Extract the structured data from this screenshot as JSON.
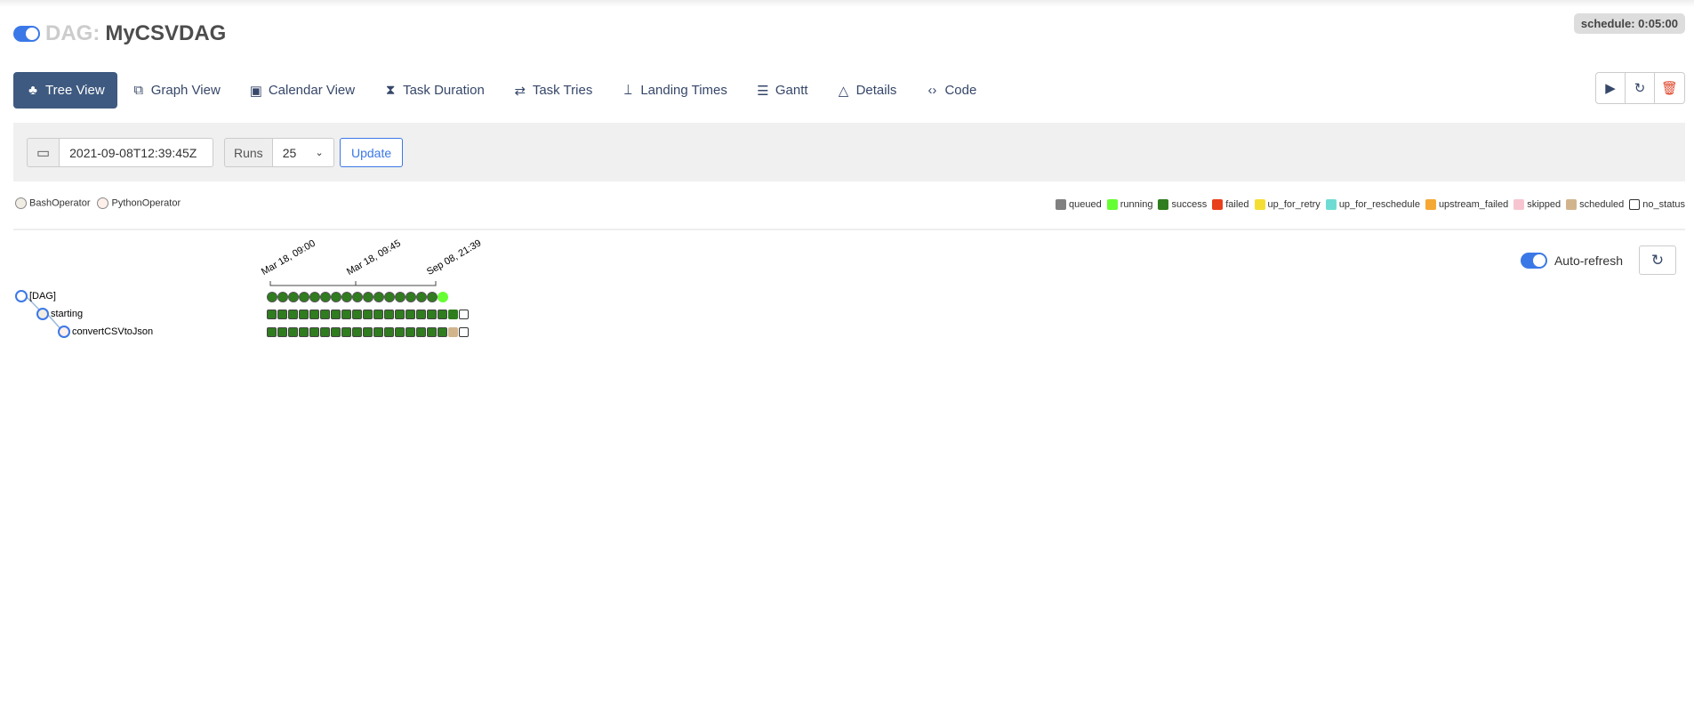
{
  "header": {
    "title_prefix": "DAG:",
    "dag_name": "MyCSVDAG",
    "schedule": "schedule: 0:05:00",
    "paused_toggle_on": true
  },
  "nav": [
    {
      "label": "Tree View",
      "icon": "tree-icon",
      "glyph": "♣",
      "active": true
    },
    {
      "label": "Graph View",
      "icon": "graph-icon",
      "glyph": "⧉"
    },
    {
      "label": "Calendar View",
      "icon": "calendar-icon",
      "glyph": "▣"
    },
    {
      "label": "Task Duration",
      "icon": "hourglass-icon",
      "glyph": "⧗"
    },
    {
      "label": "Task Tries",
      "icon": "repeat-icon",
      "glyph": "⇄"
    },
    {
      "label": "Landing Times",
      "icon": "plane-landing-icon",
      "glyph": "⟘"
    },
    {
      "label": "Gantt",
      "icon": "gantt-icon",
      "glyph": "☰"
    },
    {
      "label": "Details",
      "icon": "warning-triangle-icon",
      "glyph": "△"
    },
    {
      "label": "Code",
      "icon": "code-icon",
      "glyph": "‹›"
    }
  ],
  "actions": {
    "trigger": "▶",
    "refresh": "↻",
    "delete": "🗑"
  },
  "filter": {
    "base_date": "2021-09-08T12:39:45Z",
    "runs_label": "Runs",
    "runs_value": "25",
    "update_label": "Update"
  },
  "operators": [
    {
      "label": "BashOperator",
      "color": "#f0ede4"
    },
    {
      "label": "PythonOperator",
      "color": "#ffefeb"
    }
  ],
  "legend": [
    {
      "label": "queued",
      "color": "#808080"
    },
    {
      "label": "running",
      "color": "#66ff33"
    },
    {
      "label": "success",
      "color": "#2f7d1e"
    },
    {
      "label": "failed",
      "color": "#e8401c"
    },
    {
      "label": "up_for_retry",
      "color": "#f5de34"
    },
    {
      "label": "up_for_reschedule",
      "color": "#6fdcd3"
    },
    {
      "label": "upstream_failed",
      "color": "#f5a833"
    },
    {
      "label": "skipped",
      "color": "#f7c5cf"
    },
    {
      "label": "scheduled",
      "color": "#d2b48c"
    },
    {
      "label": "no_status",
      "color": "#ffffff"
    }
  ],
  "auto_refresh": {
    "label": "Auto-refresh",
    "on": true
  },
  "tree": {
    "ticks": [
      "Mar 18, 09:00",
      "Mar 18, 09:45",
      "Sep 08, 21:39"
    ],
    "tasks": [
      {
        "label": "[DAG]",
        "color": "#ffffff"
      },
      {
        "label": "starting",
        "color": "#f0ede4"
      },
      {
        "label": "convertCSVtoJson",
        "color": "#ffefeb"
      }
    ],
    "dag_runs": [
      "success",
      "success",
      "success",
      "success",
      "success",
      "success",
      "success",
      "success",
      "success",
      "success",
      "success",
      "success",
      "success",
      "success",
      "success",
      "success",
      "running"
    ],
    "task_instances": [
      [
        "success",
        "success",
        "success",
        "success",
        "success",
        "success",
        "success",
        "success",
        "success",
        "success",
        "success",
        "success",
        "success",
        "success",
        "success",
        "success",
        "success",
        "success",
        "no_status"
      ],
      [
        "success",
        "success",
        "success",
        "success",
        "success",
        "success",
        "success",
        "success",
        "success",
        "success",
        "success",
        "success",
        "success",
        "success",
        "success",
        "success",
        "success",
        "scheduled",
        "no_status"
      ]
    ]
  }
}
